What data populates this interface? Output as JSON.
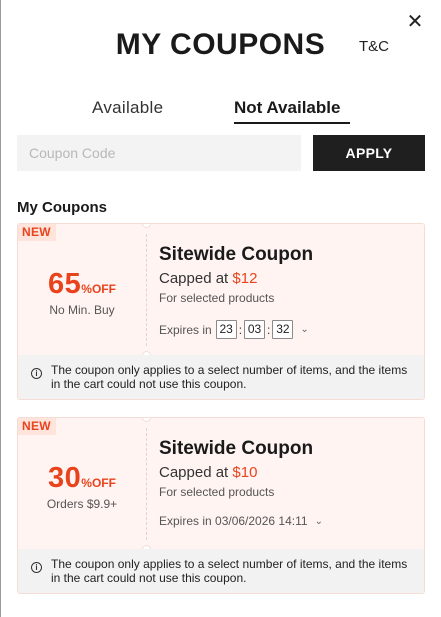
{
  "header": {
    "title": "MY COUPONS",
    "tc_label": "T&C",
    "close_glyph": "✕"
  },
  "tabs": [
    {
      "label": "Available",
      "active": false
    },
    {
      "label": "Not Available",
      "active": true
    }
  ],
  "code_form": {
    "placeholder": "Coupon Code",
    "value": "",
    "apply_label": "APPLY"
  },
  "section_title": "My Coupons",
  "coupons": [
    {
      "badge": "NEW",
      "discount": "65",
      "discount_suffix": "%OFF",
      "condition": "No Min. Buy",
      "title": "Sitewide Coupon",
      "cap_prefix": "Capped at ",
      "cap_amount": "$12",
      "scope": "For selected products",
      "expires_prefix": "Expires in",
      "countdown": {
        "h": "23",
        "m": "03",
        "s": "32"
      },
      "note": "The coupon only applies to a select number of items, and the items in the cart could not use this coupon."
    },
    {
      "badge": "NEW",
      "discount": "30",
      "discount_suffix": "%OFF",
      "condition": "Orders $9.9+",
      "title": "Sitewide Coupon",
      "cap_prefix": "Capped at ",
      "cap_amount": "$10",
      "scope": "For selected products",
      "expires_text": "Expires in 03/06/2026 14:11",
      "note": "The coupon only applies to a select number of items, and the items in the cart could not use this coupon."
    }
  ],
  "colors": {
    "accent": "#e8431d",
    "card_bg": "#fff4f1",
    "badge_bg": "#ffe4dc",
    "button_bg": "#1f1f1f"
  },
  "icons": {
    "close": "close-icon",
    "info": "info-icon",
    "expand": "chevron-down-icon"
  }
}
